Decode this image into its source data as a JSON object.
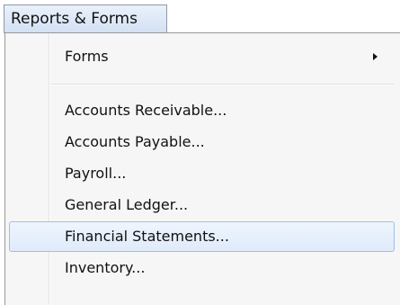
{
  "menubar": {
    "title": "Reports & Forms"
  },
  "menu": {
    "forms_label": "Forms",
    "items": [
      {
        "label": "Accounts Receivable..."
      },
      {
        "label": "Accounts Payable..."
      },
      {
        "label": "Payroll..."
      },
      {
        "label": "General Ledger..."
      },
      {
        "label": "Financial Statements..."
      },
      {
        "label": "Inventory..."
      }
    ]
  }
}
